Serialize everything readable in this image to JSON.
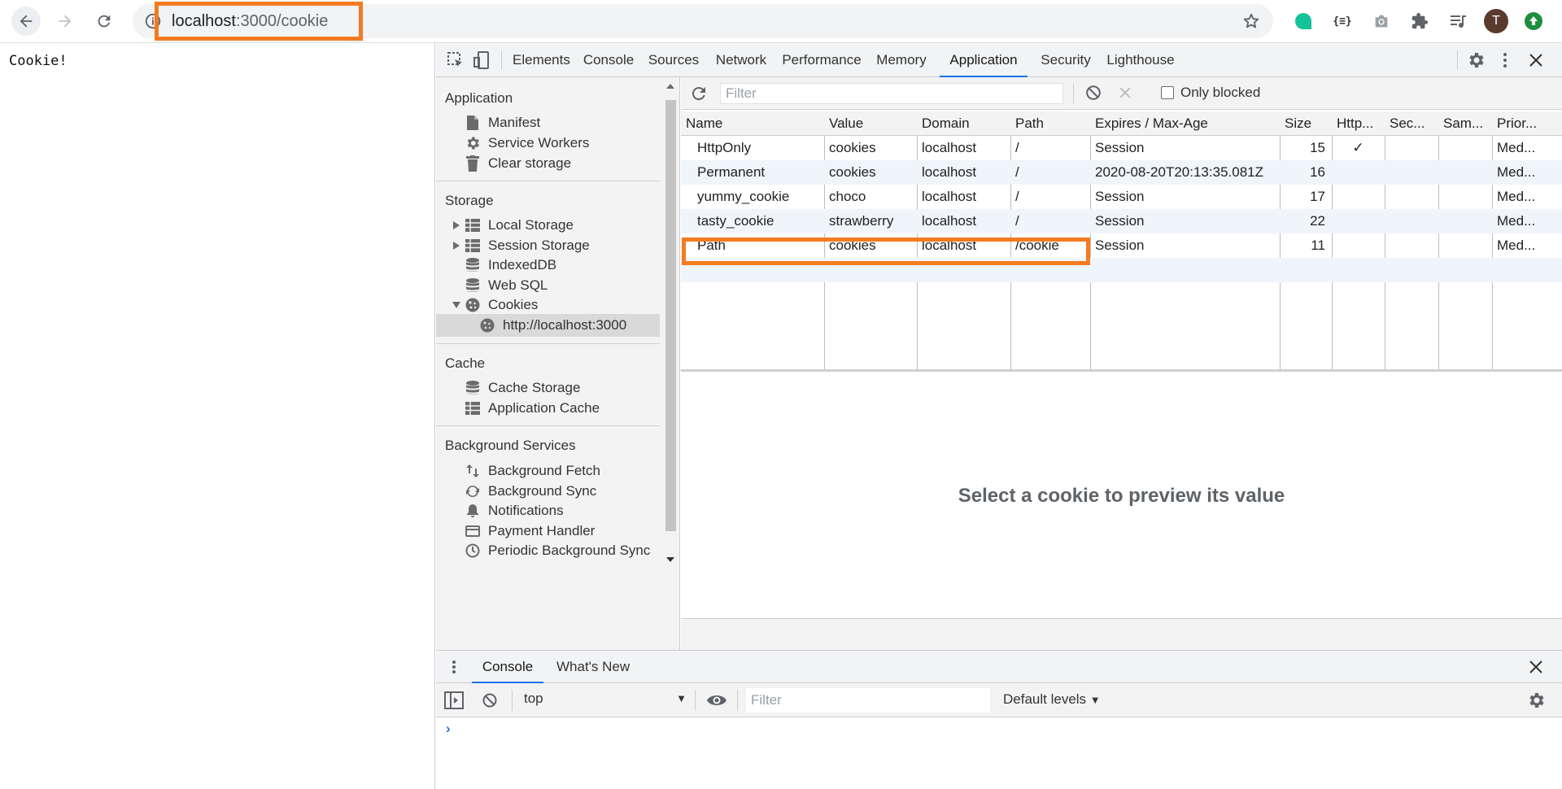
{
  "browser": {
    "url_host": "localhost",
    "url_rest": ":3000/cookie",
    "profile_initial": "T"
  },
  "page": {
    "body_text": "Cookie!"
  },
  "devtools": {
    "tabs": [
      {
        "label": "Elements"
      },
      {
        "label": "Console"
      },
      {
        "label": "Sources"
      },
      {
        "label": "Network"
      },
      {
        "label": "Performance"
      },
      {
        "label": "Memory"
      },
      {
        "label": "Application",
        "active": true
      },
      {
        "label": "Security"
      },
      {
        "label": "Lighthouse"
      }
    ],
    "sidebar": {
      "application": {
        "heading": "Application",
        "items": [
          {
            "label": "Manifest",
            "icon": "document-icon"
          },
          {
            "label": "Service Workers",
            "icon": "gear-icon"
          },
          {
            "label": "Clear storage",
            "icon": "trash-icon"
          }
        ]
      },
      "storage": {
        "heading": "Storage",
        "items": [
          {
            "label": "Local Storage",
            "icon": "grid-icon",
            "expandable": true,
            "expanded": false
          },
          {
            "label": "Session Storage",
            "icon": "grid-icon",
            "expandable": true,
            "expanded": false
          },
          {
            "label": "IndexedDB",
            "icon": "database-icon"
          },
          {
            "label": "Web SQL",
            "icon": "database-icon"
          },
          {
            "label": "Cookies",
            "icon": "cookie-icon",
            "expandable": true,
            "expanded": true
          },
          {
            "label": "http://localhost:3000",
            "icon": "cookie-icon",
            "selected": true
          }
        ]
      },
      "cache": {
        "heading": "Cache",
        "items": [
          {
            "label": "Cache Storage",
            "icon": "database-icon"
          },
          {
            "label": "Application Cache",
            "icon": "grid-icon"
          }
        ]
      },
      "background": {
        "heading": "Background Services",
        "items": [
          {
            "label": "Background Fetch",
            "icon": "swap-icon"
          },
          {
            "label": "Background Sync",
            "icon": "sync-icon"
          },
          {
            "label": "Notifications",
            "icon": "bell-icon"
          },
          {
            "label": "Payment Handler",
            "icon": "card-icon"
          },
          {
            "label": "Periodic Background Sync",
            "icon": "clock-icon"
          }
        ]
      }
    },
    "cookies": {
      "filter_placeholder": "Filter",
      "only_blocked_label": "Only blocked",
      "columns": [
        "Name",
        "Value",
        "Domain",
        "Path",
        "Expires / Max-Age",
        "Size",
        "Http...",
        "Sec...",
        "Sam...",
        "Prior..."
      ],
      "rows": [
        {
          "name": "HttpOnly",
          "value": "cookies",
          "domain": "localhost",
          "path": "/",
          "expires": "Session",
          "size": "15",
          "httponly": "✓",
          "secure": "",
          "samesite": "",
          "priority": "Med..."
        },
        {
          "name": "Permanent",
          "value": "cookies",
          "domain": "localhost",
          "path": "/",
          "expires": "2020-08-20T20:13:35.081Z",
          "size": "16",
          "httponly": "",
          "secure": "",
          "samesite": "",
          "priority": "Med..."
        },
        {
          "name": "yummy_cookie",
          "value": "choco",
          "domain": "localhost",
          "path": "/",
          "expires": "Session",
          "size": "17",
          "httponly": "",
          "secure": "",
          "samesite": "",
          "priority": "Med..."
        },
        {
          "name": "tasty_cookie",
          "value": "strawberry",
          "domain": "localhost",
          "path": "/",
          "expires": "Session",
          "size": "22",
          "httponly": "",
          "secure": "",
          "samesite": "",
          "priority": "Med..."
        },
        {
          "name": "Path",
          "value": "cookies",
          "domain": "localhost",
          "path": "/cookie",
          "expires": "Session",
          "size": "11",
          "httponly": "",
          "secure": "",
          "samesite": "",
          "priority": "Med..."
        }
      ],
      "preview_message": "Select a cookie to preview its value"
    },
    "drawer": {
      "tabs": [
        {
          "label": "Console",
          "active": true
        },
        {
          "label": "What's New"
        }
      ],
      "context": "top",
      "filter_placeholder": "Filter",
      "levels_label": "Default levels",
      "prompt": "›"
    }
  },
  "colors": {
    "highlight": "#f47b20",
    "accent": "#1a73e8",
    "alt_row": "#f0f4fb"
  }
}
